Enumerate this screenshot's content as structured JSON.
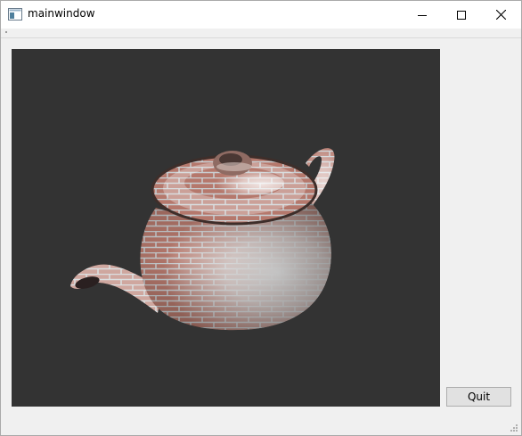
{
  "window": {
    "title": "mainwindow",
    "icons": {
      "app": "app-window-icon",
      "minimize": "minimize-icon",
      "maximize": "maximize-icon",
      "close": "close-icon"
    }
  },
  "viewport": {
    "content": "teapot-3d-render",
    "background": "#333333"
  },
  "quit_button": {
    "label": "Quit"
  },
  "colors": {
    "window_bg": "#f0f0f0",
    "titlebar_bg": "#ffffff",
    "button_bg": "#e1e1e1",
    "button_border": "#adadad"
  }
}
